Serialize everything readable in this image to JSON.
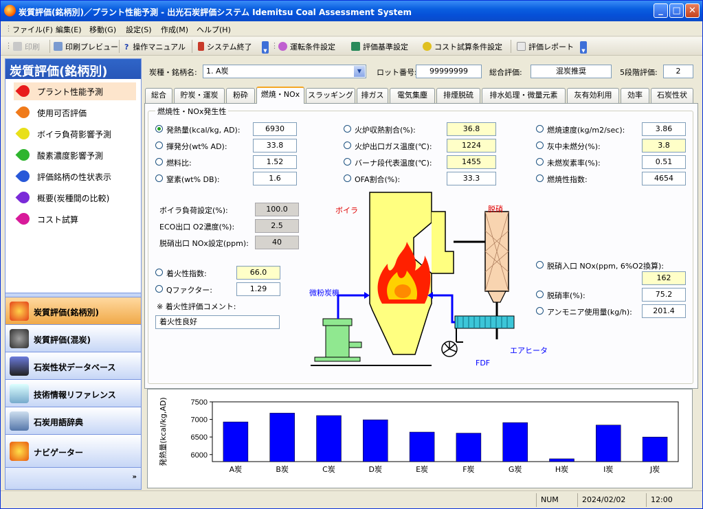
{
  "window": {
    "title": "炭質評価(銘柄別)／プラント性能予測 - 出光石炭評価システム Idemitsu Coal Assessment System"
  },
  "menu": [
    "ファイル(F)",
    "編集(E)",
    "移動(G)",
    "設定(S)",
    "作成(M)",
    "ヘルプ(H)"
  ],
  "toolbar": {
    "print": "印刷",
    "preview": "印刷プレビュー",
    "manual": "操作マニュアル",
    "exit": "システム終了",
    "op_settings": "運転条件設定",
    "criteria": "評価基準設定",
    "cost": "コスト試算条件設定",
    "report": "評価レポート"
  },
  "sidebar": {
    "title": "炭質評価(銘柄別)",
    "items": [
      {
        "label": "プラント性能予測",
        "color": "#e81c1c"
      },
      {
        "label": "使用可否評価",
        "color": "#f07a1a"
      },
      {
        "label": "ボイラ負荷影響予測",
        "color": "#e8e01a"
      },
      {
        "label": "酸素濃度影響予測",
        "color": "#2fb52f"
      },
      {
        "label": "評価銘柄の性状表示",
        "color": "#2858d8"
      },
      {
        "label": "概要(炭種間の比較)",
        "color": "#7a2ad8"
      },
      {
        "label": "コスト試算",
        "color": "#d81a9a"
      }
    ],
    "nav": [
      {
        "label": "炭質評価(銘柄別)"
      },
      {
        "label": "炭質評価(混炭)"
      },
      {
        "label": "石炭性状データベース"
      },
      {
        "label": "技術情報リファレンス"
      },
      {
        "label": "石炭用語辞典"
      },
      {
        "label": "ナビゲーター"
      }
    ]
  },
  "header": {
    "coal_label": "炭種・銘柄名:",
    "coal_value": "1. A炭",
    "lot_label": "ロット番号:",
    "lot_value": "99999999",
    "overall_label": "総合評価:",
    "overall_value": "混炭推奨",
    "grade_label": "5段階評価:",
    "grade_value": "2"
  },
  "tabs": [
    "総合",
    "貯炭・運炭",
    "粉砕",
    "燃焼・NOx",
    "スラッギング",
    "排ガス",
    "電気集塵",
    "排煙脱硫",
    "排水処理・微量元素",
    "灰有効利用",
    "効率",
    "石炭性状"
  ],
  "group_title": "燃焼性・NOx発生性",
  "col1": [
    {
      "label": "発熱量(kcal/kg, AD):",
      "value": "6930",
      "checked": true
    },
    {
      "label": "揮発分(wt% AD):",
      "value": "33.8"
    },
    {
      "label": "燃料比:",
      "value": "1.52"
    },
    {
      "label": "窒素(wt% DB):",
      "value": "1.6"
    }
  ],
  "col2": [
    {
      "label": "火炉収熱割合(%):",
      "value": "36.8"
    },
    {
      "label": "火炉出口ガス温度(℃):",
      "value": "1224"
    },
    {
      "label": "バーナ段代表温度(℃):",
      "value": "1455"
    },
    {
      "label": "OFA割合(%):",
      "value": "33.3"
    }
  ],
  "col3": [
    {
      "label": "燃焼速度(kg/m2/sec):",
      "value": "3.86"
    },
    {
      "label": "灰中未燃分(%):",
      "value": "3.8"
    },
    {
      "label": "未燃炭素率(%):",
      "value": "0.51"
    },
    {
      "label": "燃焼性指数:",
      "value": "4654"
    }
  ],
  "settings": [
    {
      "label": "ボイラ負荷設定(%):",
      "value": "100.0"
    },
    {
      "label": "ECO出口 O2濃度(%):",
      "value": "2.5"
    },
    {
      "label": "脱硝出口 NOx設定(ppm):",
      "value": "40"
    }
  ],
  "ignition": [
    {
      "label": "着火性指数:",
      "value": "66.0"
    },
    {
      "label": "Qファクター:",
      "value": "1.29"
    }
  ],
  "comment_label": "※ 着火性評価コメント:",
  "comment_value": "着火性良好",
  "denox": [
    {
      "label": "脱硝入口 NOx(ppm, 6%O2換算):",
      "value": "162"
    },
    {
      "label": "脱硝率(%):",
      "value": "75.2"
    },
    {
      "label": "アンモニア使用量(kg/h):",
      "value": "201.4"
    }
  ],
  "diagram": {
    "boiler": "ボイラ",
    "denox": "脱硝",
    "mill": "微粉炭機",
    "fdf": "FDF",
    "airheater": "エアヒータ"
  },
  "chart_data": {
    "type": "bar",
    "categories": [
      "A炭",
      "B炭",
      "C炭",
      "D炭",
      "E炭",
      "F炭",
      "G炭",
      "H炭",
      "I炭",
      "J炭"
    ],
    "values": [
      6930,
      7180,
      7110,
      6990,
      6640,
      6610,
      6910,
      5880,
      6840,
      6500
    ],
    "ylabel": "発熱量(kcal/kg,AD)",
    "ylim": [
      5800,
      7500
    ],
    "yticks": [
      6000,
      6500,
      7000,
      7500
    ],
    "bar_color": "#0000ff"
  },
  "status": {
    "num": "NUM",
    "date": "2024/02/02",
    "time": "12:00"
  }
}
